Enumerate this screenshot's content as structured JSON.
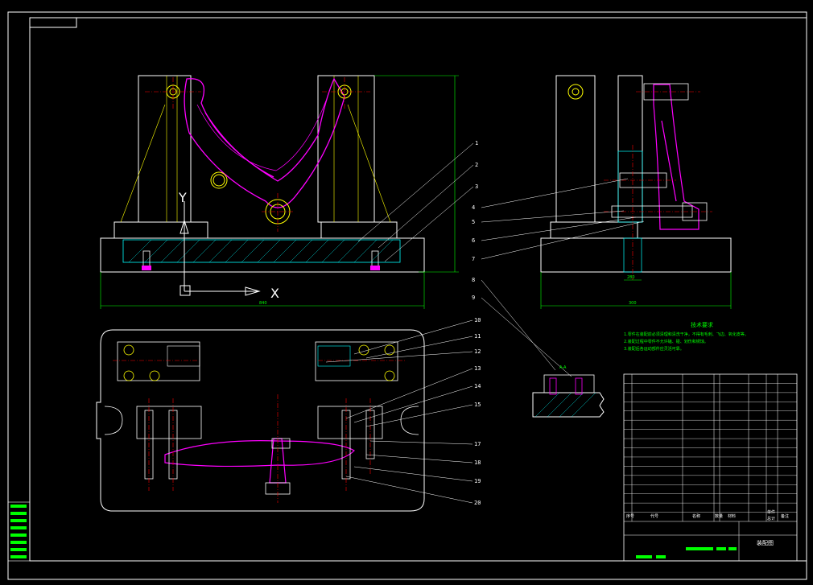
{
  "drawing": {
    "background": "#000000",
    "colors": {
      "outline": "#ffffff",
      "part": "#ff00ff",
      "dimension": "#00ff00",
      "leader": "#ffff00",
      "center": "#ff0000",
      "hatch": "#00ffff"
    },
    "axes": {
      "y_label": "Y",
      "x_label": "X"
    },
    "callouts_front": [
      "1",
      "2",
      "3"
    ],
    "callouts_side": [
      "4",
      "5",
      "6",
      "7"
    ],
    "callouts_plan": [
      "10",
      "11",
      "12",
      "13",
      "14",
      "15",
      "17",
      "18",
      "19",
      "20"
    ],
    "callouts_section": [
      "8",
      "9"
    ],
    "section_mark": "A-A",
    "dimension_front_width": "840",
    "dimension_side_width": "300",
    "dimension_side_height": "280",
    "technical_requirements_title": "技术要求",
    "technical_requirements": [
      "1.零件在装配前必须清理和清洗干净，不得有毛刺、飞边、氧化皮等。",
      "2.装配过程中零件不允许磕、碰、划伤和锈蚀。",
      "3.装配后各运动部件应灵活可靠。"
    ],
    "title_block": {
      "drawing_name": "装配图",
      "header": [
        "序号",
        "代号",
        "名称",
        "数量",
        "材料",
        "单件",
        "总计",
        "备注"
      ],
      "rows_count": 15
    }
  }
}
